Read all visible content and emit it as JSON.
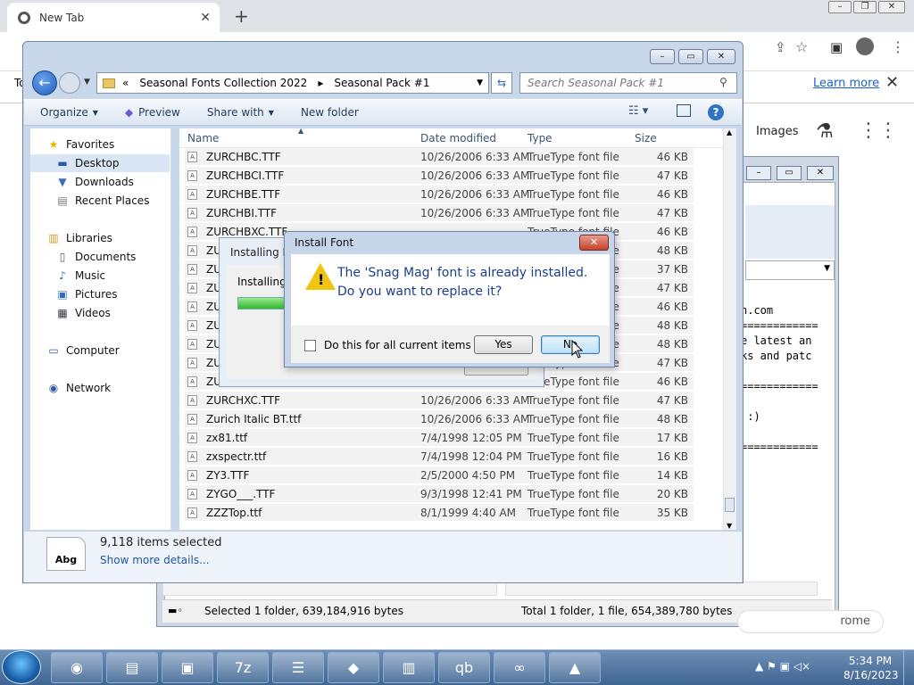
{
  "chrome": {
    "tab_title": "New Tab",
    "tab_close": "✕",
    "new_tab": "+",
    "info_prefix": "To",
    "learn_more": "Learn more",
    "info_close": "✕",
    "images_link": "Images",
    "pill_text": "rome"
  },
  "bg_window": {
    "text_lines": "n.com\n============\ne latest an\nks and patc\n\n============\n\n :)\n\n============",
    "status_left": "Selected 1 folder, 639,184,916 bytes",
    "status_right": "Total 1 folder, 1 file, 654,389,780 bytes"
  },
  "explorer": {
    "breadcrumb": [
      "«",
      "Seasonal Fonts Collection 2022",
      "▸",
      "Seasonal Pack #1"
    ],
    "search_placeholder": "Search Seasonal Pack #1",
    "toolbar": {
      "organize": "Organize",
      "preview": "Preview",
      "share_with": "Share with",
      "new_folder": "New folder"
    },
    "nav": [
      {
        "label": "Favorites",
        "icon": "star-icon",
        "glyph": "★",
        "indent": 0
      },
      {
        "label": "Desktop",
        "icon": "desktop-icon",
        "glyph": "▬",
        "indent": 1,
        "selected": true
      },
      {
        "label": "Downloads",
        "icon": "downloads-icon",
        "glyph": "▼",
        "indent": 1
      },
      {
        "label": "Recent Places",
        "icon": "recent-places-icon",
        "glyph": "▤",
        "indent": 1
      },
      {
        "label": "Libraries",
        "icon": "libraries-icon",
        "glyph": "▥",
        "indent": 0
      },
      {
        "label": "Documents",
        "icon": "documents-icon",
        "glyph": "▯",
        "indent": 1
      },
      {
        "label": "Music",
        "icon": "music-icon",
        "glyph": "♪",
        "indent": 1
      },
      {
        "label": "Pictures",
        "icon": "pictures-icon",
        "glyph": "▣",
        "indent": 1
      },
      {
        "label": "Videos",
        "icon": "videos-icon",
        "glyph": "▦",
        "indent": 1
      },
      {
        "label": "Computer",
        "icon": "computer-icon",
        "glyph": "▭",
        "indent": 0
      },
      {
        "label": "Network",
        "icon": "network-icon",
        "glyph": "◉",
        "indent": 0
      }
    ],
    "columns": {
      "name": "Name",
      "date": "Date modified",
      "type": "Type",
      "size": "Size"
    },
    "rows": [
      {
        "name": "ZURCHBC.TTF",
        "date": "10/26/2006 6:33 AM",
        "type": "TrueType font file",
        "size": "46 KB"
      },
      {
        "name": "ZURCHBCI.TTF",
        "date": "10/26/2006 6:33 AM",
        "type": "TrueType font file",
        "size": "47 KB"
      },
      {
        "name": "ZURCHBE.TTF",
        "date": "10/26/2006 6:33 AM",
        "type": "TrueType font file",
        "size": "46 KB"
      },
      {
        "name": "ZURCHBI.TTF",
        "date": "10/26/2006 6:33 AM",
        "type": "TrueType font file",
        "size": "47 KB"
      },
      {
        "name": "ZURCHBXC.TTF",
        "date": "",
        "type": "TrueType font file",
        "size": "46 KB"
      },
      {
        "name": "ZU",
        "date": "",
        "type": "TrueType font file",
        "size": "48 KB"
      },
      {
        "name": "ZU",
        "date": "",
        "type": "TrueType font file",
        "size": "37 KB"
      },
      {
        "name": "ZU",
        "date": "",
        "type": "TrueType font file",
        "size": "47 KB"
      },
      {
        "name": "ZU",
        "date": "",
        "type": "TrueType font file",
        "size": "46 KB"
      },
      {
        "name": "ZU",
        "date": "",
        "type": "TrueType font file",
        "size": "48 KB"
      },
      {
        "name": "ZU",
        "date": "",
        "type": "TrueType font file",
        "size": "48 KB"
      },
      {
        "name": "ZU",
        "date": "",
        "type": "TrueType font file",
        "size": "47 KB"
      },
      {
        "name": "ZURCHN.TTF",
        "date": "10/26/2006 6:33 AM",
        "type": "TrueType font file",
        "size": "46 KB"
      },
      {
        "name": "ZURCHXC.TTF",
        "date": "10/26/2006 6:33 AM",
        "type": "TrueType font file",
        "size": "47 KB"
      },
      {
        "name": "Zurich Italic BT.ttf",
        "date": "10/26/2006 6:33 AM",
        "type": "TrueType font file",
        "size": "48 KB"
      },
      {
        "name": "zx81.ttf",
        "date": "7/4/1998 12:05 PM",
        "type": "TrueType font file",
        "size": "17 KB"
      },
      {
        "name": "zxspectr.ttf",
        "date": "7/4/1998 12:04 PM",
        "type": "TrueType font file",
        "size": "16 KB"
      },
      {
        "name": "ZY3.TTF",
        "date": "2/5/2000 4:50 PM",
        "type": "TrueType font file",
        "size": "14 KB"
      },
      {
        "name": "ZYGO___.TTF",
        "date": "9/3/1998 12:41 PM",
        "type": "TrueType font file",
        "size": "20 KB"
      },
      {
        "name": "ZZZTop.ttf",
        "date": "8/1/1999 4:40 AM",
        "type": "TrueType font file",
        "size": "35 KB"
      }
    ],
    "details": {
      "icon_text": "Abg",
      "count": "9,118 items selected",
      "more": "Show more details..."
    }
  },
  "installing": {
    "title": "Installing Fo",
    "label": "Installing"
  },
  "dialog": {
    "title": "Install Font",
    "close": "✕",
    "message_line1": "The 'Snag Mag' font is already installed.",
    "message_line2": "Do you want to replace it?",
    "checkbox_label": "Do this for all current items",
    "yes": "Yes",
    "no": "No"
  },
  "taskbar": {
    "apps": [
      {
        "name": "chrome",
        "glyph": "◉"
      },
      {
        "name": "file-explorer",
        "glyph": "▤"
      },
      {
        "name": "network-tool",
        "glyph": "▣"
      },
      {
        "name": "7zip",
        "glyph": "7z"
      },
      {
        "name": "notepad",
        "glyph": "☰"
      },
      {
        "name": "cat-app",
        "glyph": "◆"
      },
      {
        "name": "winrar",
        "glyph": "▥"
      },
      {
        "name": "qbittorrent",
        "glyph": "qb"
      },
      {
        "name": "infinity-app",
        "glyph": "∞"
      },
      {
        "name": "font-folder",
        "glyph": "▲"
      }
    ],
    "time": "5:34 PM",
    "date": "8/16/2023"
  }
}
